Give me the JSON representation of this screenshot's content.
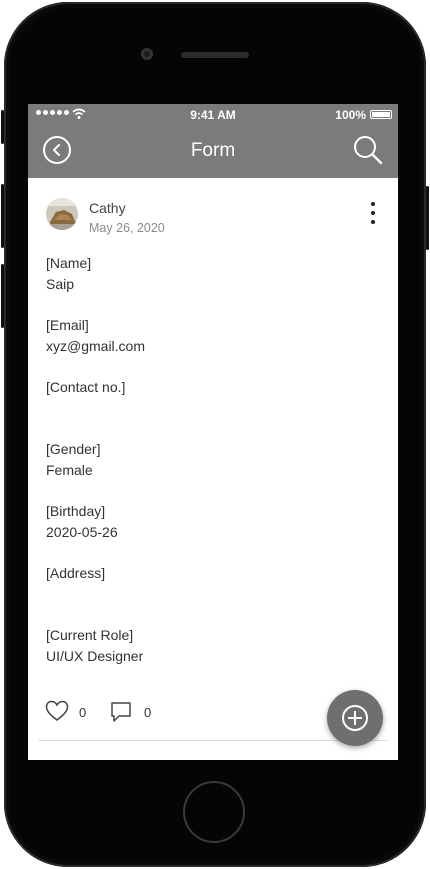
{
  "status_bar": {
    "time": "9:41 AM",
    "battery": "100%"
  },
  "nav": {
    "title": "Form",
    "back_icon": "chevron-left-circle-icon",
    "search_icon": "search-icon"
  },
  "post": {
    "author": "Cathy",
    "date": "May 26, 2020",
    "more_icon": "more-vertical-icon",
    "fields": [
      {
        "label": "[Name]",
        "value": "Saip"
      },
      {
        "label": "[Email]",
        "value": "xyz@gmail.com"
      },
      {
        "label": "[Contact no.]",
        "value": ""
      },
      {
        "label": "[Gender]",
        "value": "Female"
      },
      {
        "label": "[Birthday]",
        "value": "2020-05-26"
      },
      {
        "label": "[Address]",
        "value": ""
      },
      {
        "label": "[Current Role]",
        "value": "UI/UX Designer"
      }
    ],
    "likes": "0",
    "comments": "0"
  },
  "colors": {
    "header_bg": "#7b7b7b",
    "fab_bg": "#6f6f6f"
  }
}
